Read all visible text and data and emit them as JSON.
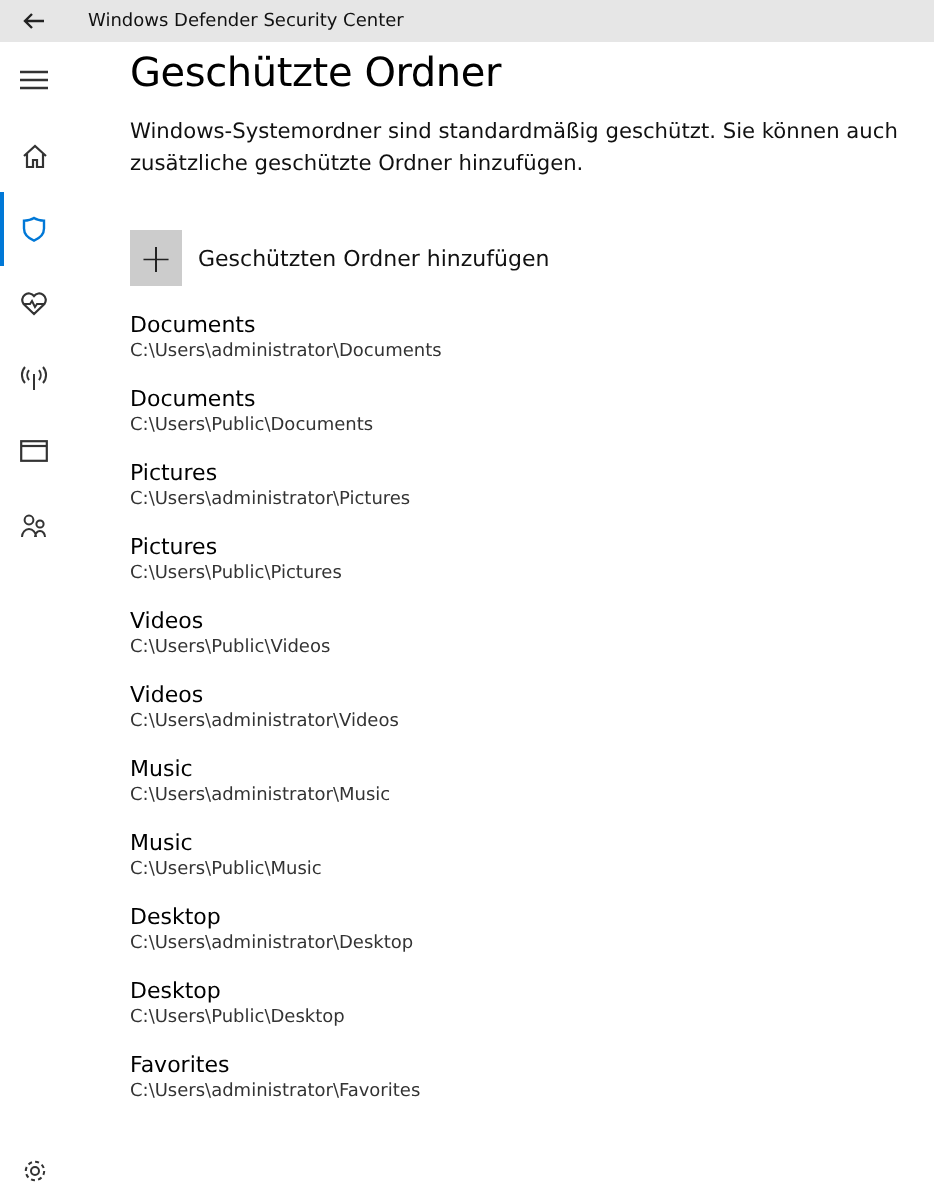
{
  "window": {
    "title": "Windows Defender Security Center"
  },
  "sidebar": {
    "items": [
      {
        "kind": "menu",
        "selected": false
      },
      {
        "kind": "home",
        "selected": false
      },
      {
        "kind": "shield",
        "selected": true
      },
      {
        "kind": "heart",
        "selected": false
      },
      {
        "kind": "antenna",
        "selected": false
      },
      {
        "kind": "browser",
        "selected": false
      },
      {
        "kind": "family",
        "selected": false
      }
    ],
    "footer": {
      "kind": "settings"
    }
  },
  "page": {
    "heading": "Geschützte Ordner",
    "description": "Windows-Systemordner sind standardmäßig geschützt. Sie können auch zusätzliche geschützte Ordner hinzufügen.",
    "add_button": {
      "icon": "+",
      "label": "Geschützten Ordner hinzufügen"
    }
  },
  "folders": [
    {
      "name": "Documents",
      "path": "C:\\Users\\administrator\\Documents"
    },
    {
      "name": "Documents",
      "path": "C:\\Users\\Public\\Documents"
    },
    {
      "name": "Pictures",
      "path": "C:\\Users\\administrator\\Pictures"
    },
    {
      "name": "Pictures",
      "path": "C:\\Users\\Public\\Pictures"
    },
    {
      "name": "Videos",
      "path": "C:\\Users\\Public\\Videos"
    },
    {
      "name": "Videos",
      "path": "C:\\Users\\administrator\\Videos"
    },
    {
      "name": "Music",
      "path": "C:\\Users\\administrator\\Music"
    },
    {
      "name": "Music",
      "path": "C:\\Users\\Public\\Music"
    },
    {
      "name": "Desktop",
      "path": "C:\\Users\\administrator\\Desktop"
    },
    {
      "name": "Desktop",
      "path": "C:\\Users\\Public\\Desktop"
    },
    {
      "name": "Favorites",
      "path": "C:\\Users\\administrator\\Favorites"
    }
  ]
}
